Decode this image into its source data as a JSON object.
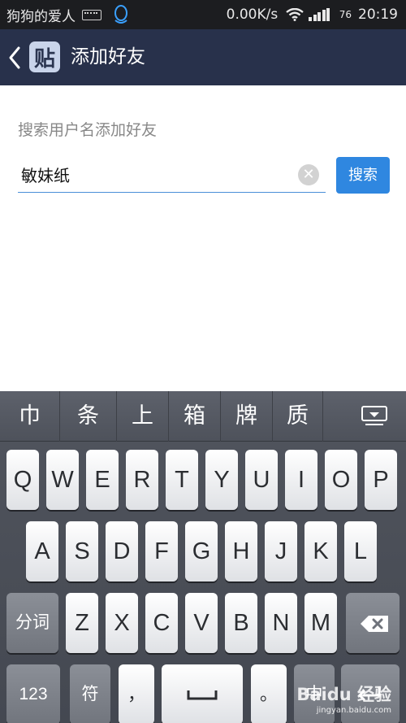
{
  "status_bar": {
    "notification_title": "狗狗的爱人",
    "network_speed": "0.00K/s",
    "battery": "76",
    "time": "20:19"
  },
  "header": {
    "logo_char": "贴",
    "title": "添加好友"
  },
  "content": {
    "hint_label": "搜索用户名添加好友",
    "search_value": "敏妹纸",
    "search_button_label": "搜索"
  },
  "keyboard": {
    "candidates": [
      "巾",
      "条",
      "上",
      "箱",
      "牌",
      "质"
    ],
    "row1": [
      "Q",
      "W",
      "E",
      "R",
      "T",
      "Y",
      "U",
      "I",
      "O",
      "P"
    ],
    "row2": [
      "A",
      "S",
      "D",
      "F",
      "G",
      "H",
      "J",
      "K",
      "L"
    ],
    "row3_left": "分词",
    "row3": [
      "Z",
      "X",
      "C",
      "V",
      "B",
      "N",
      "M"
    ],
    "bottom": {
      "numbers": "123",
      "symbols": "符",
      "comma": "，",
      "period": "。",
      "lang": "中"
    }
  },
  "watermark": {
    "brand": "Baidu 经验",
    "site": "jingyan.baidu.com"
  },
  "colors": {
    "status_bar": "#1c1d20",
    "header": "#28314b",
    "accent": "#2f87e0",
    "keyboard": "#4a4e57"
  }
}
